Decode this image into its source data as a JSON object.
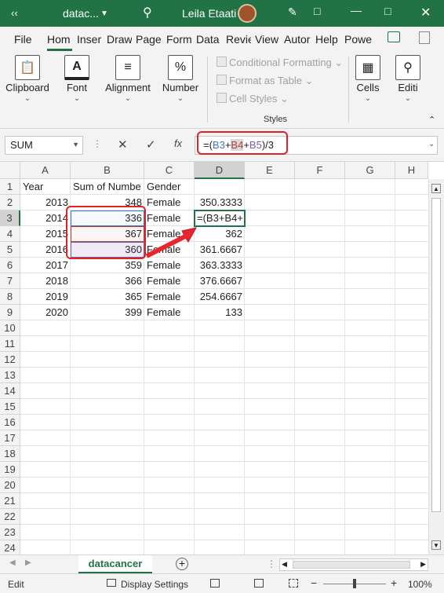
{
  "titlebar": {
    "back_icon": "chevron-left-icon",
    "file_name": "datac...",
    "user_name": "Leila Etaati"
  },
  "ribbon": {
    "tabs": [
      "File",
      "Hom",
      "Inser",
      "Draw",
      "Page",
      "Form",
      "Data",
      "Revie",
      "View",
      "Autor",
      "Help",
      "Powe"
    ],
    "groups": {
      "clipboard": "Clipboard",
      "font": "Font",
      "alignment": "Alignment",
      "number": "Number",
      "number_glyph": "%",
      "conditional_formatting": "Conditional Formatting",
      "format_as_table": "Format as Table",
      "cell_styles": "Cell Styles",
      "styles": "Styles",
      "cells": "Cells",
      "editing": "Editi"
    }
  },
  "formula_bar": {
    "name_box": "SUM",
    "fx": "fx",
    "formula": "=(B3+B4+B5)/3"
  },
  "grid": {
    "columns": [
      "A",
      "B",
      "C",
      "D",
      "E",
      "F",
      "G",
      "H"
    ],
    "row_numbers": [
      "1",
      "2",
      "3",
      "4",
      "5",
      "6",
      "7",
      "8",
      "9",
      "10",
      "11",
      "12",
      "13",
      "14",
      "15",
      "16",
      "17",
      "18",
      "19",
      "20",
      "21",
      "22",
      "23",
      "24"
    ],
    "rows": [
      [
        "Year",
        "Sum of Numbe",
        "Gender",
        ""
      ],
      [
        "2013",
        "348",
        "Female",
        "350.3333"
      ],
      [
        "2014",
        "336",
        "Female",
        "=(B3+B4+"
      ],
      [
        "2015",
        "367",
        "Female",
        "362"
      ],
      [
        "2016",
        "360",
        "Female",
        "361.6667"
      ],
      [
        "2017",
        "359",
        "Female",
        "363.3333"
      ],
      [
        "2018",
        "366",
        "Female",
        "376.6667"
      ],
      [
        "2019",
        "365",
        "Female",
        "254.6667"
      ],
      [
        "2020",
        "399",
        "Female",
        "133"
      ]
    ]
  },
  "sheet_tabs": {
    "active": "datacancer"
  },
  "status": {
    "mode": "Edit",
    "display_settings": "Display Settings",
    "zoom": "100%"
  }
}
